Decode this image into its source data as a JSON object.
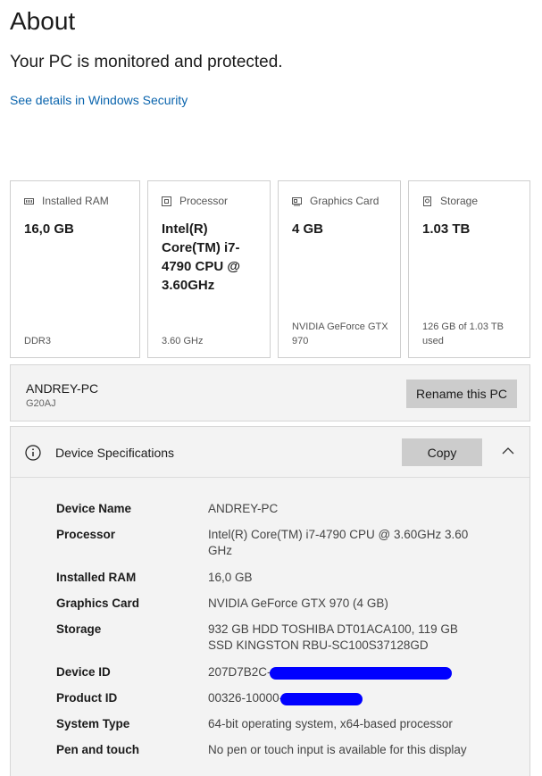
{
  "header": {
    "title": "About",
    "status": "Your PC is monitored and protected.",
    "security_link": "See details in Windows Security"
  },
  "cards": [
    {
      "label": "Installed RAM",
      "value": "16,0 GB",
      "sub": "DDR3",
      "icon": "ram-icon"
    },
    {
      "label": "Processor",
      "value": "Intel(R) Core(TM) i7-4790 CPU @ 3.60GHz",
      "sub": "3.60 GHz",
      "icon": "processor-icon"
    },
    {
      "label": "Graphics Card",
      "value": "4 GB",
      "sub": "NVIDIA GeForce GTX 970",
      "icon": "graphics-card-icon"
    },
    {
      "label": "Storage",
      "value": "1.03 TB",
      "sub": "126 GB of 1.03 TB used",
      "icon": "storage-icon"
    }
  ],
  "pc": {
    "name": "ANDREY-PC",
    "model": "G20AJ",
    "rename_label": "Rename this PC"
  },
  "specs": {
    "title": "Device Specifications",
    "copy_label": "Copy",
    "rows": [
      {
        "key": "Device Name",
        "value": "ANDREY-PC"
      },
      {
        "key": "Processor",
        "value": "Intel(R) Core(TM) i7-4790 CPU @ 3.60GHz 3.60 GHz"
      },
      {
        "key": "Installed RAM",
        "value": "16,0 GB"
      },
      {
        "key": "Graphics Card",
        "value": "NVIDIA GeForce GTX 970 (4 GB)"
      },
      {
        "key": "Storage",
        "value": "932 GB HDD TOSHIBA DT01ACA100, 119 GB SSD KINGSTON RBU-SC100S37128GD"
      },
      {
        "key": "Device ID",
        "value": "207D7B2C-"
      },
      {
        "key": "Product ID",
        "value": "00326-10000-"
      },
      {
        "key": "System Type",
        "value": "64-bit operating system, x64-based processor"
      },
      {
        "key": "Pen and touch",
        "value": "No pen or touch input is available for this display"
      }
    ]
  },
  "colors": {
    "link": "#0a64ad",
    "redaction": "#0000ff",
    "button": "#cccccc",
    "panel": "#f3f3f3"
  }
}
